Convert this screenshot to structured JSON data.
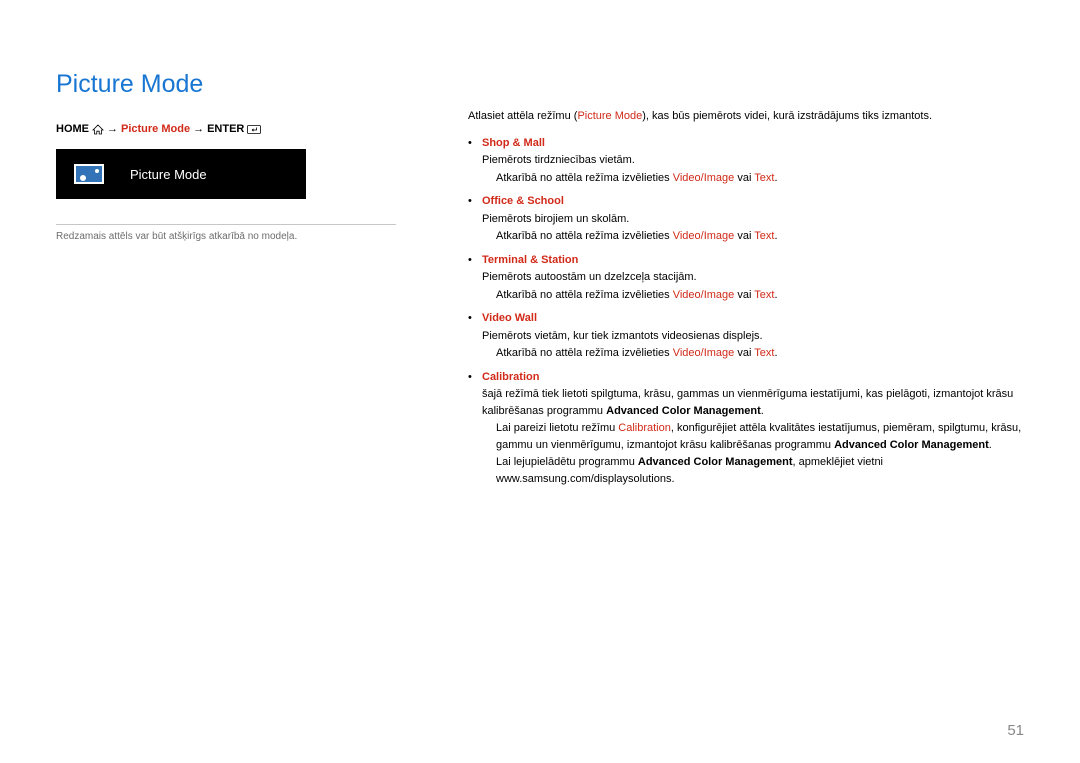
{
  "heading": "Picture Mode",
  "breadcrumb": {
    "home": "HOME",
    "picture_mode": "Picture Mode",
    "enter": "ENTER"
  },
  "ui_screenshot_label": "Picture Mode",
  "note": "Redzamais attēls var būt atšķirīgs atkarībā no modeļa.",
  "intro_pre": "Atlasiet attēla režīmu (",
  "intro_term": "Picture Mode",
  "intro_post": "), kas būs piemērots videi, kurā izstrādājums tiks izmantots.",
  "sub_prefix": "Atkarībā no attēla režīma izvēlieties ",
  "sub_term1": "Video/Image",
  "sub_mid": " vai ",
  "sub_term2": "Text",
  "sub_suffix": ".",
  "modes": {
    "shop_mall": {
      "name": "Shop & Mall",
      "desc": "Piemērots tirdzniecības vietām."
    },
    "office_school": {
      "name": "Office & School",
      "desc": "Piemērots birojiem un skolām."
    },
    "terminal_station": {
      "name": "Terminal & Station",
      "desc": "Piemērots autoostām un dzelzceļa stacijām."
    },
    "video_wall": {
      "name": "Video Wall",
      "desc": "Piemērots vietām, kur tiek izmantots videosienas displejs."
    },
    "calibration": {
      "name": "Calibration",
      "desc_pre": "šajā režīmā tiek lietoti spilgtuma, krāsu, gammas un vienmērīguma iestatījumi, kas pielāgoti, izmantojot krāsu kalibrēšanas programmu ",
      "desc_term": "Advanced Color Management",
      "desc_post": ".",
      "sub1_pre": "Lai pareizi lietotu režīmu ",
      "sub1_term1": "Calibration",
      "sub1_mid": ", konfigurējiet attēla kvalitātes iestatījumus, piemēram, spilgtumu, krāsu, gammu un vienmērīgumu, izmantojot krāsu kalibrēšanas programmu ",
      "sub1_term2": "Advanced Color Management",
      "sub1_post": ".",
      "sub2_pre": "Lai lejupielādētu programmu ",
      "sub2_term": "Advanced Color Management",
      "sub2_post": ", apmeklējiet vietni www.samsung.com/displaysolutions."
    }
  },
  "page_number": "51"
}
